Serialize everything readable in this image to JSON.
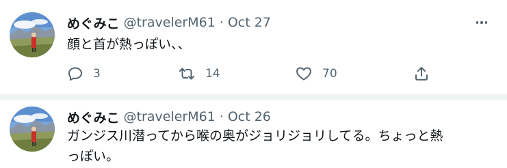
{
  "tweets": [
    {
      "author_name": "めぐみこ",
      "handle": "@travelerM61",
      "separator": "·",
      "date": "Oct 27",
      "text": "顔と首が熱っぽい、、",
      "reply_count": "3",
      "retweet_count": "14",
      "like_count": "70"
    },
    {
      "author_name": "めぐみこ",
      "handle": "@travelerM61",
      "separator": "·",
      "date": "Oct 26",
      "text_line1": "ガンジス川潜ってから喉の奥がジョリジョリしてる。ちょっと熱",
      "text_line2": "っぽい。"
    }
  ],
  "icons": {
    "reply": "reply-icon",
    "retweet": "retweet-icon",
    "like": "heart-icon",
    "share": "share-icon",
    "more": "more-icon"
  },
  "colors": {
    "text_primary": "#0f1419",
    "text_secondary": "#536471",
    "divider": "#eff3f4"
  }
}
